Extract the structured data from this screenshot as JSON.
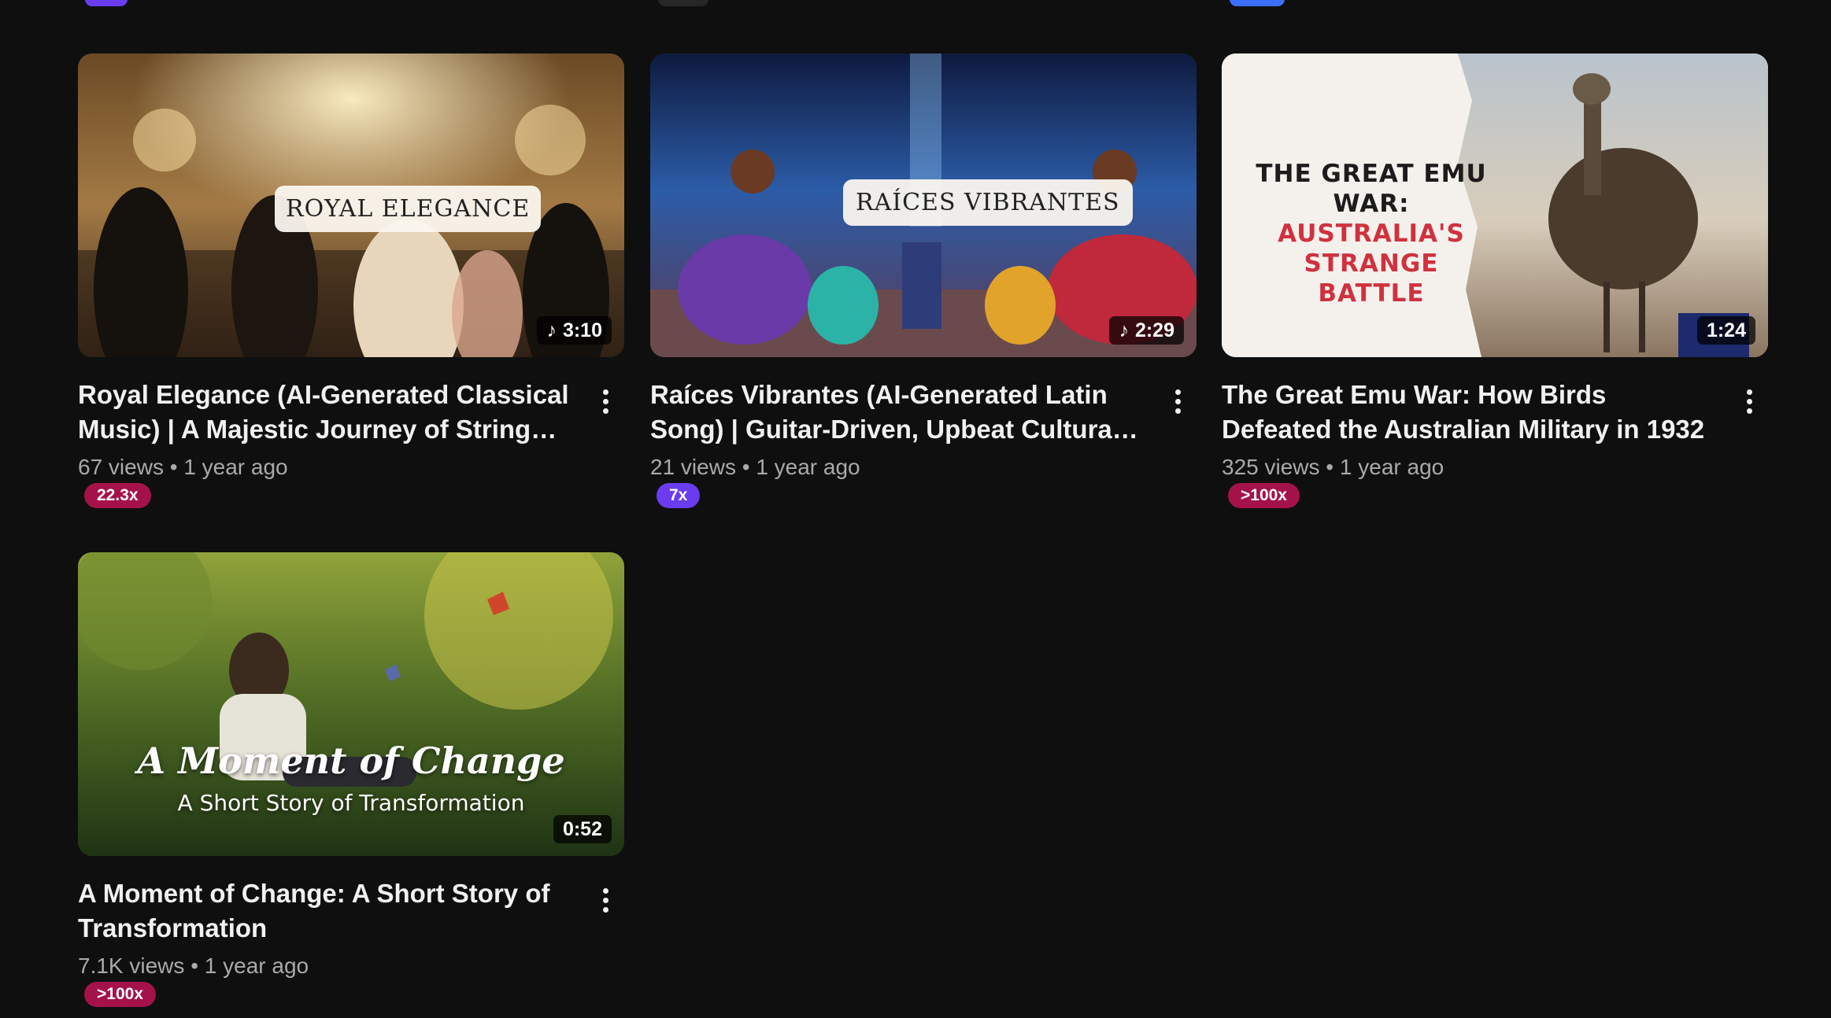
{
  "colors": {
    "background": "#0f0f0f",
    "badge_red": "#a5124a",
    "badge_purple": "#6a3cf0",
    "stub_purple": "#6a3cf0",
    "stub_gray": "#272727",
    "stub_blue": "#3b6fff"
  },
  "videos": [
    {
      "title": "Royal Elegance (AI-Generated Classical Music) | A Majestic Journey of Strings, Gra…",
      "views": "67 views",
      "age": "1 year ago",
      "duration": "3:10",
      "music_icon": "music-note-icon",
      "badge": "22.3x",
      "badge_color": "#a5124a",
      "thumbnail_text": "ROYAL ELEGANCE"
    },
    {
      "title": "Raíces Vibrantes (AI-Generated Latin Song) | Guitar-Driven, Upbeat Cultural Celebration o…",
      "views": "21 views",
      "age": "1 year ago",
      "duration": "2:29",
      "music_icon": "music-note-icon",
      "badge": "7x",
      "badge_color": "#6a3cf0",
      "thumbnail_text": "RAÍCES VIBRANTES"
    },
    {
      "title": "The Great Emu War: How Birds Defeated the Australian Military in 1932",
      "views": "325 views",
      "age": "1 year ago",
      "duration": "1:24",
      "badge": ">100x",
      "badge_color": "#a5124a",
      "thumbnail_line1": "THE GREAT EMU WAR:",
      "thumbnail_line2": "AUSTRALIA'S STRANGE",
      "thumbnail_line3": "BATTLE"
    },
    {
      "title": "A Moment of Change: A Short Story of Transformation",
      "views": "7.1K views",
      "age": "1 year ago",
      "duration": "0:52",
      "badge": ">100x",
      "badge_color": "#a5124a",
      "thumbnail_title": "A Moment of Change",
      "thumbnail_subtitle": "A Short Story of Transformation"
    }
  ],
  "separator": "•"
}
